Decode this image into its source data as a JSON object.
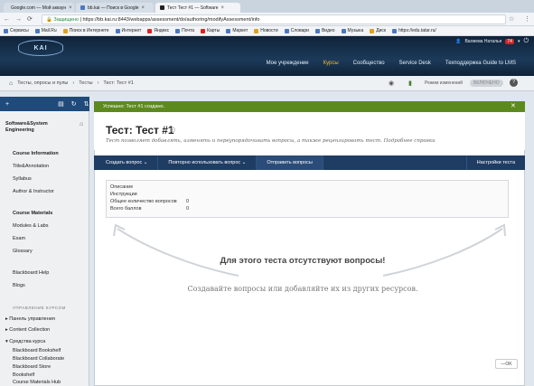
{
  "browser": {
    "tabs": [
      {
        "label": "Google.com — Мой аккаун"
      },
      {
        "label": "bb.kai — Поиск в Google"
      },
      {
        "label": "Тест Тест #1 — Software"
      }
    ],
    "secure_label": "Защищено",
    "url": "https://bb.kai.ru:8443/webapps/assessment/do/authoring/modifyAssessment/info",
    "bookmarks": [
      "Сервисы",
      "Mail.Ru",
      "Поиск в Интернете",
      "Интернет",
      "Яндекс",
      "Почта",
      "Карты",
      "Маркет",
      "Новости",
      "Словари",
      "Видео",
      "Музыка",
      "Диск",
      "https://edu.tatar.ru/"
    ]
  },
  "header": {
    "logo_text": "KAI",
    "user_name": "Валиева Наталья",
    "badge": "74",
    "nav": [
      "Мое учреждение",
      "Курсы",
      "Сообщество",
      "Service Desk",
      "Техподдержка Guide to LMS"
    ]
  },
  "breadcrumb": {
    "items": [
      "Тесты, опросы и пулы",
      "Тесты",
      "Тест: Тест #1"
    ],
    "edit_mode": "Режим изменений",
    "edit_state": "ВКЛЮЧЕНО"
  },
  "course": {
    "title": "Software&System Engineering",
    "section1": "Course Information",
    "items1": [
      "Title&Annotation",
      "Syllabus",
      "Author & Instructor"
    ],
    "section2": "Course Materials",
    "items2": [
      "Modules & Labs",
      "Exam",
      "Glossary"
    ],
    "items3": [
      "Blackboard Help",
      "Blogs"
    ],
    "mgmt_heading": "УПРАВЛЕНИЕ КУРСОМ",
    "mgmt_items": [
      "Панель управления",
      "Content Collection"
    ],
    "tools_heading": "Средства курса",
    "tools_items": [
      "Blackboard Bookshelf",
      "Blackboard Collaborate",
      "Blackboard Store",
      "Bookshelf",
      "Course Materials Hub"
    ]
  },
  "main": {
    "success": "Успешно: Тест #1 создано.",
    "title": "Тест: Тест #1",
    "description": "Тест позволяет добавлять, изменять и переупорядочивать вопросы, а также рецензировать тест. Подробнее справки",
    "actions": [
      "Создать вопрос",
      "Повторно использовать вопрос",
      "Отправить вопросы"
    ],
    "settings": "Настройки теста",
    "info_labels": [
      "Описание",
      "Инструкции",
      "Общее количество вопросов",
      "Всего баллов"
    ],
    "info_values": [
      "",
      "",
      "0",
      "0"
    ],
    "empty_title": "Для этого теста отсутствуют вопросы!",
    "empty_sub": "Создавайте вопросы или добавляйте их из других ресурсов.",
    "ok": "OK"
  }
}
